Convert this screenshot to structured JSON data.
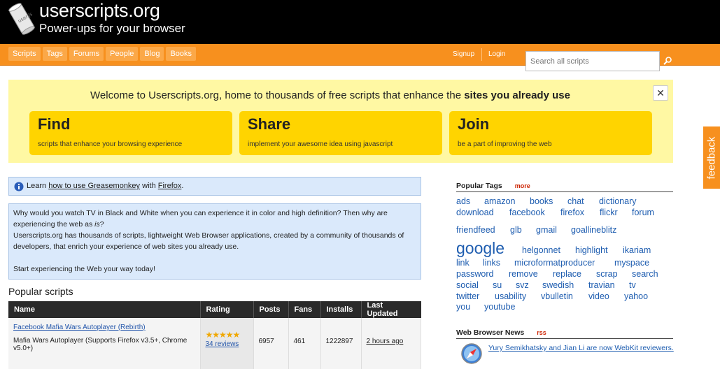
{
  "header": {
    "site_title": "userscripts.org",
    "tagline": "Power-ups for your browser",
    "logo_icon": "scroll-logo-icon"
  },
  "nav": {
    "items": [
      "Scripts",
      "Tags",
      "Forums",
      "People",
      "Blog",
      "Books"
    ],
    "signup": "Signup",
    "login": "Login",
    "search_placeholder": "Search all scripts",
    "search_icon": "magnifier-icon"
  },
  "welcome": {
    "prefix": "Welcome to Userscripts.org, home to thousands of free scripts that enhance the ",
    "bold": "sites you already use",
    "close": "✕",
    "cards": [
      {
        "title": "Find",
        "desc": "scripts that enhance your browsing experience"
      },
      {
        "title": "Share",
        "desc": "implement your awesome idea using javascript"
      },
      {
        "title": "Join",
        "desc": "be a part of improving the web"
      }
    ]
  },
  "learn": {
    "prefix": "Learn ",
    "link1": "how to use Greasemonkey",
    "middle": " with ",
    "link2": "Firefox",
    "suffix": "."
  },
  "intro": {
    "line1a": "Why would you watch TV in Black and White when you can experience it in color and high definition? Then why are experiencing the web as ",
    "line1_em": "is",
    "line1b": "?",
    "line2": "Userscripts.org has thousands of scripts, lightweight Web Browser applications, created by a community of thousands of developers, that enrich your experience of web sites you already use.",
    "line3": "Start experiencing the Web your way today!"
  },
  "popular": {
    "heading": "Popular scripts",
    "columns": [
      "Name",
      "Rating",
      "Posts",
      "Fans",
      "Installs",
      "Last Updated"
    ],
    "rows": [
      {
        "name": "Facebook Mafia Wars Autoplayer (Rebirth)",
        "desc": "Mafia Wars Autoplayer (Supports Firefox v3.5+, Chrome v5.0+)",
        "stars": "★★★★★",
        "reviews": "34 reviews",
        "posts": "6957",
        "fans": "461",
        "installs": "1222897",
        "updated": "2 hours ago"
      }
    ]
  },
  "tags": {
    "heading": "Popular Tags",
    "more": "more",
    "items": [
      "ads",
      "amazon",
      "books",
      "chat",
      "dictionary",
      "download",
      "facebook",
      "firefox",
      "flickr",
      "forum",
      "friendfeed",
      "glb",
      "gmail",
      "goallineblitz",
      "google",
      "helgonnet",
      "highlight",
      "ikariam",
      "link",
      "links",
      "microformatproducer",
      "myspace",
      "password",
      "remove",
      "replace",
      "scrap",
      "search",
      "social",
      "su",
      "svz",
      "swedish",
      "travian",
      "tv",
      "twitter",
      "usability",
      "vbulletin",
      "video",
      "yahoo",
      "you",
      "youtube"
    ]
  },
  "news": {
    "heading": "Web Browser News",
    "rss": "rss",
    "items": [
      {
        "text": "Yury Semikhatsky and Jian Li are now WebKit reviewers.",
        "icon": "safari-compass-icon"
      }
    ]
  },
  "feedback": "feedback"
}
